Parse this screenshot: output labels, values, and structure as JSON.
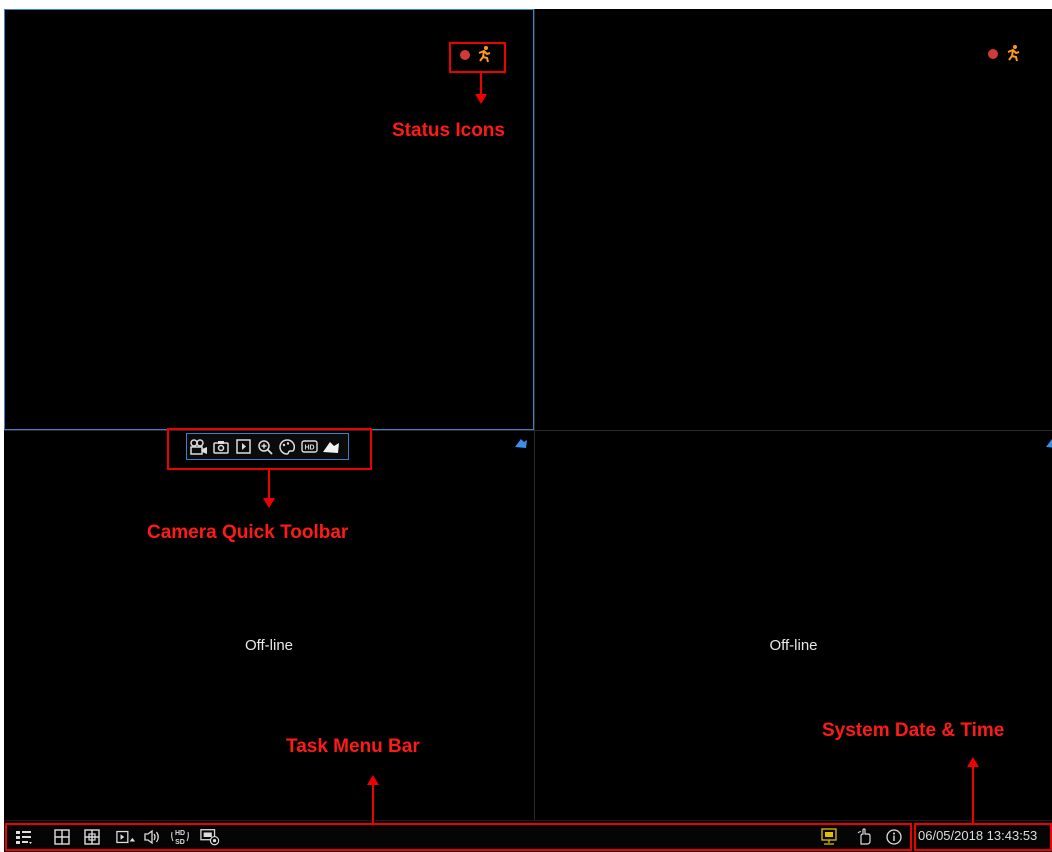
{
  "cameras": [
    {
      "status": ""
    },
    {
      "status": ""
    },
    {
      "status": "Off-line"
    },
    {
      "status": "Off-line"
    }
  ],
  "annotations": {
    "status_icons": "Status Icons",
    "camera_toolbar": "Camera Quick Toolbar",
    "task_menu_bar": "Task Menu Bar",
    "system_datetime": "System Date & Time"
  },
  "taskbar": {
    "datetime": "06/05/2018 13:43:53"
  },
  "icons": {
    "status": [
      "record-indicator-icon",
      "motion-detection-icon"
    ],
    "quick_toolbar": [
      "manual-record-icon",
      "snapshot-icon",
      "instant-playback-icon",
      "zoom-icon",
      "color-adjust-icon",
      "stream-hd-icon",
      "ptz-camera-icon"
    ],
    "taskbar_left": [
      "start-menu-icon",
      "layout-4-icon",
      "layout-9-icon",
      "sequence-icon",
      "volume-icon",
      "hd-sd-toggle-icon",
      "record-status-icon"
    ],
    "taskbar_right": [
      "network-icon",
      "manual-alarm-icon",
      "info-icon"
    ]
  },
  "colors": {
    "annotation": "#ee0000",
    "selected_border": "#3b82c4",
    "record_dot": "#d23a3a",
    "motion_icon": "#ff9a1f",
    "camera_icon": "#3b8fe8"
  }
}
